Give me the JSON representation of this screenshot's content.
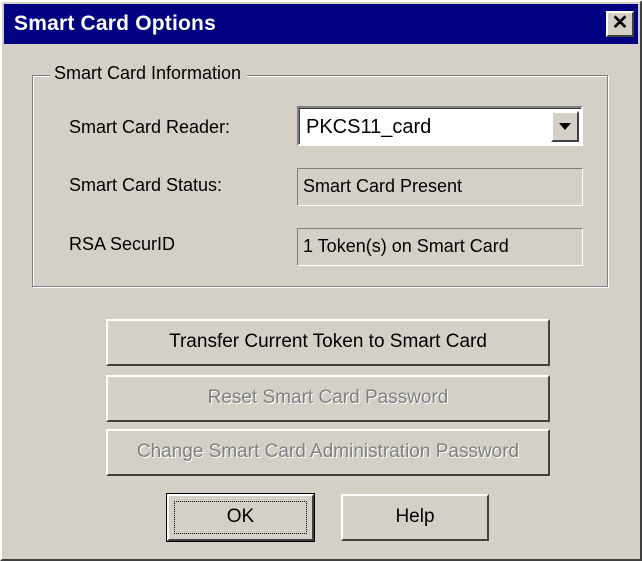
{
  "window": {
    "title": "Smart Card Options",
    "close_glyph": "✕"
  },
  "group": {
    "legend": "Smart Card Information",
    "reader_label": "Smart Card Reader:",
    "reader_value": "PKCS11_card",
    "status_label": "Smart Card Status:",
    "status_value": "Smart Card Present",
    "securid_label": "RSA SecurID",
    "securid_value": "1 Token(s) on Smart Card"
  },
  "buttons": {
    "transfer": "Transfer Current Token to Smart Card",
    "reset": "Reset Smart Card Password",
    "change_admin": "Change Smart Card Administration Password",
    "ok": "OK",
    "help": "Help"
  },
  "icons": {
    "dropdown": "chevron-down-icon",
    "close": "close-icon"
  },
  "colors": {
    "titlebar": "#000080",
    "face": "#d4d0c8",
    "disabled_text": "#808080"
  }
}
